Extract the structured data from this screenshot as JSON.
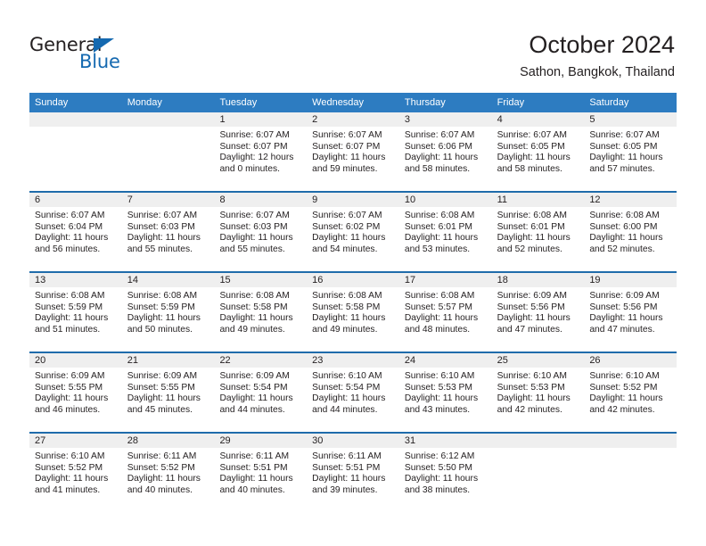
{
  "brand": {
    "name_dark": "General",
    "name_blue": "Blue",
    "accent_color": "#1569b0"
  },
  "header": {
    "title": "October 2024",
    "subtitle": "Sathon, Bangkok, Thailand"
  },
  "calendar": {
    "header_color": "#2d7cc1",
    "row_divider_color": "#1f6cab",
    "day_band_color": "#efefef",
    "weekdays": [
      "Sunday",
      "Monday",
      "Tuesday",
      "Wednesday",
      "Thursday",
      "Friday",
      "Saturday"
    ],
    "weeks": [
      [
        {
          "day": "",
          "lines": []
        },
        {
          "day": "",
          "lines": []
        },
        {
          "day": "1",
          "lines": [
            "Sunrise: 6:07 AM",
            "Sunset: 6:07 PM",
            "Daylight: 12 hours",
            "and 0 minutes."
          ]
        },
        {
          "day": "2",
          "lines": [
            "Sunrise: 6:07 AM",
            "Sunset: 6:07 PM",
            "Daylight: 11 hours",
            "and 59 minutes."
          ]
        },
        {
          "day": "3",
          "lines": [
            "Sunrise: 6:07 AM",
            "Sunset: 6:06 PM",
            "Daylight: 11 hours",
            "and 58 minutes."
          ]
        },
        {
          "day": "4",
          "lines": [
            "Sunrise: 6:07 AM",
            "Sunset: 6:05 PM",
            "Daylight: 11 hours",
            "and 58 minutes."
          ]
        },
        {
          "day": "5",
          "lines": [
            "Sunrise: 6:07 AM",
            "Sunset: 6:05 PM",
            "Daylight: 11 hours",
            "and 57 minutes."
          ]
        }
      ],
      [
        {
          "day": "6",
          "lines": [
            "Sunrise: 6:07 AM",
            "Sunset: 6:04 PM",
            "Daylight: 11 hours",
            "and 56 minutes."
          ]
        },
        {
          "day": "7",
          "lines": [
            "Sunrise: 6:07 AM",
            "Sunset: 6:03 PM",
            "Daylight: 11 hours",
            "and 55 minutes."
          ]
        },
        {
          "day": "8",
          "lines": [
            "Sunrise: 6:07 AM",
            "Sunset: 6:03 PM",
            "Daylight: 11 hours",
            "and 55 minutes."
          ]
        },
        {
          "day": "9",
          "lines": [
            "Sunrise: 6:07 AM",
            "Sunset: 6:02 PM",
            "Daylight: 11 hours",
            "and 54 minutes."
          ]
        },
        {
          "day": "10",
          "lines": [
            "Sunrise: 6:08 AM",
            "Sunset: 6:01 PM",
            "Daylight: 11 hours",
            "and 53 minutes."
          ]
        },
        {
          "day": "11",
          "lines": [
            "Sunrise: 6:08 AM",
            "Sunset: 6:01 PM",
            "Daylight: 11 hours",
            "and 52 minutes."
          ]
        },
        {
          "day": "12",
          "lines": [
            "Sunrise: 6:08 AM",
            "Sunset: 6:00 PM",
            "Daylight: 11 hours",
            "and 52 minutes."
          ]
        }
      ],
      [
        {
          "day": "13",
          "lines": [
            "Sunrise: 6:08 AM",
            "Sunset: 5:59 PM",
            "Daylight: 11 hours",
            "and 51 minutes."
          ]
        },
        {
          "day": "14",
          "lines": [
            "Sunrise: 6:08 AM",
            "Sunset: 5:59 PM",
            "Daylight: 11 hours",
            "and 50 minutes."
          ]
        },
        {
          "day": "15",
          "lines": [
            "Sunrise: 6:08 AM",
            "Sunset: 5:58 PM",
            "Daylight: 11 hours",
            "and 49 minutes."
          ]
        },
        {
          "day": "16",
          "lines": [
            "Sunrise: 6:08 AM",
            "Sunset: 5:58 PM",
            "Daylight: 11 hours",
            "and 49 minutes."
          ]
        },
        {
          "day": "17",
          "lines": [
            "Sunrise: 6:08 AM",
            "Sunset: 5:57 PM",
            "Daylight: 11 hours",
            "and 48 minutes."
          ]
        },
        {
          "day": "18",
          "lines": [
            "Sunrise: 6:09 AM",
            "Sunset: 5:56 PM",
            "Daylight: 11 hours",
            "and 47 minutes."
          ]
        },
        {
          "day": "19",
          "lines": [
            "Sunrise: 6:09 AM",
            "Sunset: 5:56 PM",
            "Daylight: 11 hours",
            "and 47 minutes."
          ]
        }
      ],
      [
        {
          "day": "20",
          "lines": [
            "Sunrise: 6:09 AM",
            "Sunset: 5:55 PM",
            "Daylight: 11 hours",
            "and 46 minutes."
          ]
        },
        {
          "day": "21",
          "lines": [
            "Sunrise: 6:09 AM",
            "Sunset: 5:55 PM",
            "Daylight: 11 hours",
            "and 45 minutes."
          ]
        },
        {
          "day": "22",
          "lines": [
            "Sunrise: 6:09 AM",
            "Sunset: 5:54 PM",
            "Daylight: 11 hours",
            "and 44 minutes."
          ]
        },
        {
          "day": "23",
          "lines": [
            "Sunrise: 6:10 AM",
            "Sunset: 5:54 PM",
            "Daylight: 11 hours",
            "and 44 minutes."
          ]
        },
        {
          "day": "24",
          "lines": [
            "Sunrise: 6:10 AM",
            "Sunset: 5:53 PM",
            "Daylight: 11 hours",
            "and 43 minutes."
          ]
        },
        {
          "day": "25",
          "lines": [
            "Sunrise: 6:10 AM",
            "Sunset: 5:53 PM",
            "Daylight: 11 hours",
            "and 42 minutes."
          ]
        },
        {
          "day": "26",
          "lines": [
            "Sunrise: 6:10 AM",
            "Sunset: 5:52 PM",
            "Daylight: 11 hours",
            "and 42 minutes."
          ]
        }
      ],
      [
        {
          "day": "27",
          "lines": [
            "Sunrise: 6:10 AM",
            "Sunset: 5:52 PM",
            "Daylight: 11 hours",
            "and 41 minutes."
          ]
        },
        {
          "day": "28",
          "lines": [
            "Sunrise: 6:11 AM",
            "Sunset: 5:52 PM",
            "Daylight: 11 hours",
            "and 40 minutes."
          ]
        },
        {
          "day": "29",
          "lines": [
            "Sunrise: 6:11 AM",
            "Sunset: 5:51 PM",
            "Daylight: 11 hours",
            "and 40 minutes."
          ]
        },
        {
          "day": "30",
          "lines": [
            "Sunrise: 6:11 AM",
            "Sunset: 5:51 PM",
            "Daylight: 11 hours",
            "and 39 minutes."
          ]
        },
        {
          "day": "31",
          "lines": [
            "Sunrise: 6:12 AM",
            "Sunset: 5:50 PM",
            "Daylight: 11 hours",
            "and 38 minutes."
          ]
        },
        {
          "day": "",
          "lines": []
        },
        {
          "day": "",
          "lines": []
        }
      ]
    ]
  }
}
